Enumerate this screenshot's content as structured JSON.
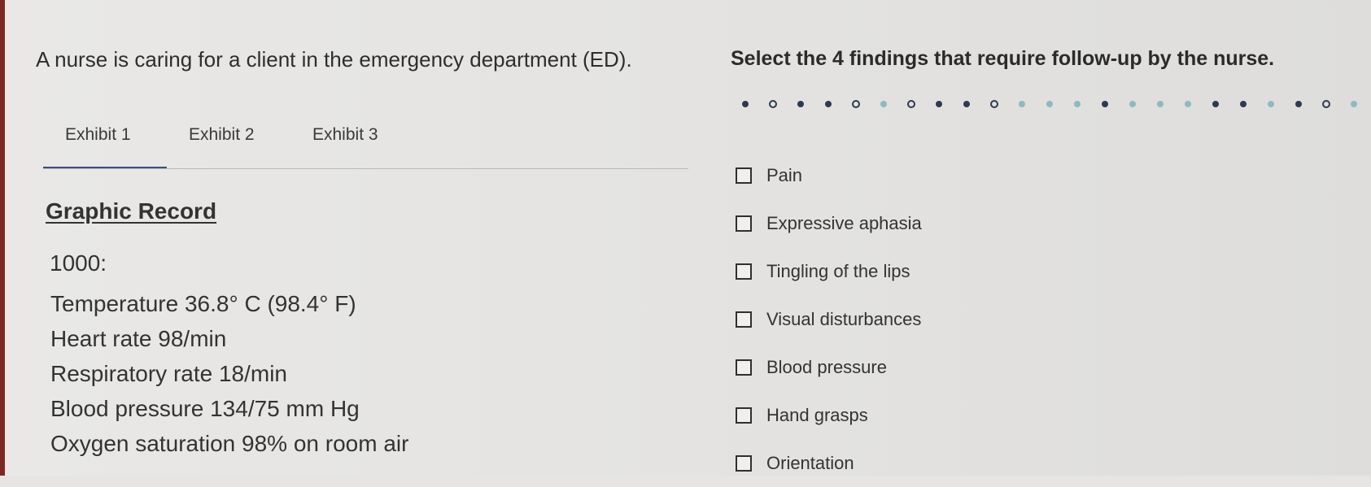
{
  "stem": "A nurse is caring for a client in the emergency department (ED).",
  "tabs": [
    {
      "label": "Exhibit 1",
      "active": true
    },
    {
      "label": "Exhibit 2",
      "active": false
    },
    {
      "label": "Exhibit 3",
      "active": false
    }
  ],
  "record": {
    "title": "Graphic Record",
    "time": "1000:",
    "vitals": [
      "Temperature 36.8° C (98.4° F)",
      "Heart rate 98/min",
      "Respiratory rate 18/min",
      "Blood pressure 134/75 mm Hg",
      "Oxygen saturation 98% on room air"
    ]
  },
  "question": "Select the 4 findings that require follow-up by the nurse.",
  "options": [
    "Pain",
    "Expressive aphasia",
    "Tingling of the lips",
    "Visual disturbances",
    "Blood pressure",
    "Hand grasps",
    "Orientation"
  ],
  "colors": {
    "tab_underline": "#3c4f7a",
    "dot_dark": "#2f3a50",
    "dot_teal": "#8fb9c0"
  }
}
